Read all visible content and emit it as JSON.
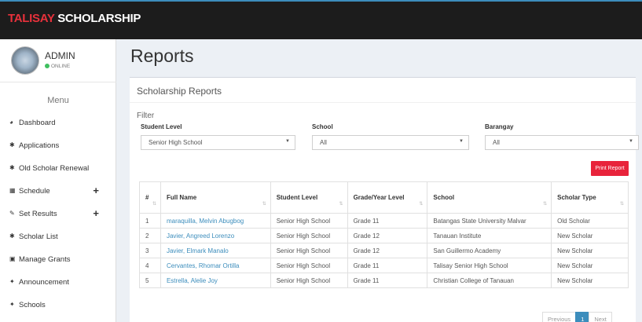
{
  "brand": {
    "part1": "TALISAY",
    "part2": "SCHOLARSHIP"
  },
  "user": {
    "name": "ADMIN",
    "status": "ONLINE"
  },
  "sidebar": {
    "menu_title": "Menu",
    "items": [
      {
        "label": "Dashboard",
        "icon": "dashboard-icon",
        "glyph": "◕",
        "has_plus": false
      },
      {
        "label": "Applications",
        "icon": "users-icon",
        "glyph": "✱",
        "has_plus": false
      },
      {
        "label": "Old Scholar Renewal",
        "icon": "users-icon",
        "glyph": "✱",
        "has_plus": false
      },
      {
        "label": "Schedule",
        "icon": "calendar-icon",
        "glyph": "▦",
        "has_plus": true,
        "plus": "+"
      },
      {
        "label": "Set Results",
        "icon": "pencil-icon",
        "glyph": "✎",
        "has_plus": true,
        "plus": "+"
      },
      {
        "label": "Scholar List",
        "icon": "users-icon",
        "glyph": "✱",
        "has_plus": false
      },
      {
        "label": "Manage Grants",
        "icon": "grant-icon",
        "glyph": "▣",
        "has_plus": false
      },
      {
        "label": "Announcement",
        "icon": "bullhorn-icon",
        "glyph": "✦",
        "has_plus": false
      },
      {
        "label": "Schools",
        "icon": "school-icon",
        "glyph": "✦",
        "has_plus": false
      }
    ]
  },
  "page": {
    "title": "Reports"
  },
  "box": {
    "title": "Scholarship Reports"
  },
  "filter": {
    "label": "Filter",
    "student_level": {
      "label": "Student Level",
      "value": "Senior High School"
    },
    "school": {
      "label": "School",
      "value": "All"
    },
    "barangay": {
      "label": "Barangay",
      "value": "All"
    }
  },
  "print_button": "Print Report",
  "table": {
    "columns": [
      "#",
      "Full Name",
      "Student Level",
      "Grade/Year Level",
      "School",
      "Scholar Type"
    ],
    "rows": [
      [
        "1",
        "maraquilla, Melvin Abugbog",
        "Senior High School",
        "Grade 11",
        "Batangas State University Malvar",
        "Old Scholar"
      ],
      [
        "2",
        "Javier, Angreed Lorenzo",
        "Senior High School",
        "Grade 12",
        "Tanauan Institute",
        "New Scholar"
      ],
      [
        "3",
        "Javier, Elmark Manalo",
        "Senior High School",
        "Grade 12",
        "San Guillermo Academy",
        "New Scholar"
      ],
      [
        "4",
        "Cervantes, Rhomar Ortilla",
        "Senior High School",
        "Grade 11",
        "Talisay Senior High School",
        "New Scholar"
      ],
      [
        "5",
        "Estrella, Alelie Joy",
        "Senior High School",
        "Grade 11",
        "Christian College of Tanauan",
        "New Scholar"
      ]
    ]
  },
  "pagination": {
    "previous": "Previous",
    "current": "1",
    "next": "Next"
  },
  "colors": {
    "accent": "#3c8dbc",
    "brand_red": "#e8313b",
    "print_button": "#e8233b",
    "topbar": "#1c1c1c"
  }
}
